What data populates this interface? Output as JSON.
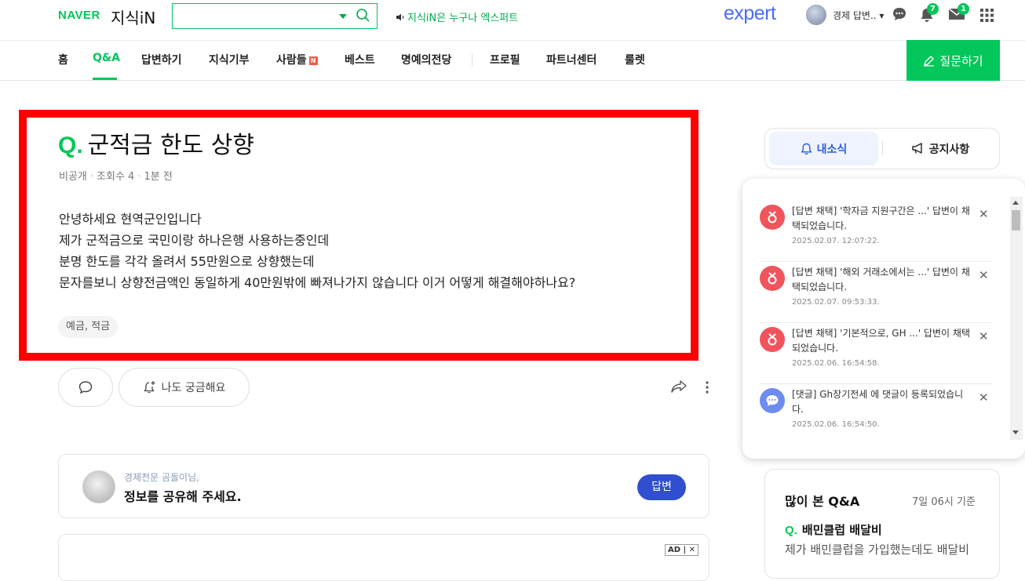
{
  "header": {
    "logo_naver": "NAVER",
    "logo_service": "지식iN",
    "search_placeholder": "",
    "promo_text": "지식iN은 누구나 엑스퍼트",
    "expert_logo": "expert",
    "user_name": "경제 답변..",
    "notifications_count": "7",
    "mail_count": "1"
  },
  "nav": {
    "items": [
      "홈",
      "Q&A",
      "답변하기",
      "지식기부",
      "사람들",
      "베스트",
      "명예의전당",
      "프로필",
      "파트너센터",
      "룰렛"
    ],
    "people_badge": "N",
    "active": "Q&A",
    "ask_button": "질문하기"
  },
  "question": {
    "q_mark": "Q.",
    "title": "군적금 한도 상향",
    "visibility": "비공개",
    "views": "조회수 4",
    "time": "1분 전",
    "body": "안녕하세요 현역군인입니다\n제가 군적금으로 국민이랑 하나은행 사용하는중인데\n분명 한도를 각각 올려서 55만원으로 상향했는데\n문자를보니 상향전금액인 동일하게 40만원밖에 빠져나가지 않습니다 이거 어떻게 해결해야하나요?",
    "tag": "예금, 적금",
    "curious_button": "나도 궁금해요"
  },
  "answer_prompt": {
    "subtitle": "경제전문 곰돌이님,",
    "message": "정보를 공유해 주세요.",
    "button": "답변"
  },
  "ad": {
    "badge": "AD",
    "close": "✕"
  },
  "sidebar": {
    "tab_my_news": "내소식",
    "tab_notice": "공지사항",
    "notifications": [
      {
        "text": "[답변 채택] '학자금 지원구간은 ...' 답변이 채택되었습니다.",
        "date": "2025.02.07. 12:07:22.",
        "type": "adopt"
      },
      {
        "text": "[답변 채택] '해외 거래소에서는 ...' 답변이 채택되었습니다.",
        "date": "2025.02.07. 09:53:33.",
        "type": "adopt"
      },
      {
        "text": "[답변 채택] '기본적으로, GH ...' 답변이 채택되었습니다.",
        "date": "2025.02.06. 16:54:58.",
        "type": "adopt"
      },
      {
        "text": "[댓글] Gh장기전세 에 댓글이 등록되었습니다.",
        "date": "2025.02.06. 16:54:50.",
        "type": "comment"
      }
    ],
    "popular_title": "많이 본 Q&A",
    "popular_date": "7일 06시 기준",
    "popular_q_mark": "Q.",
    "popular_q_title": "배민클럽 배달비",
    "popular_q_body": "제가 배민클럽을 가입했는데도 배달비"
  }
}
